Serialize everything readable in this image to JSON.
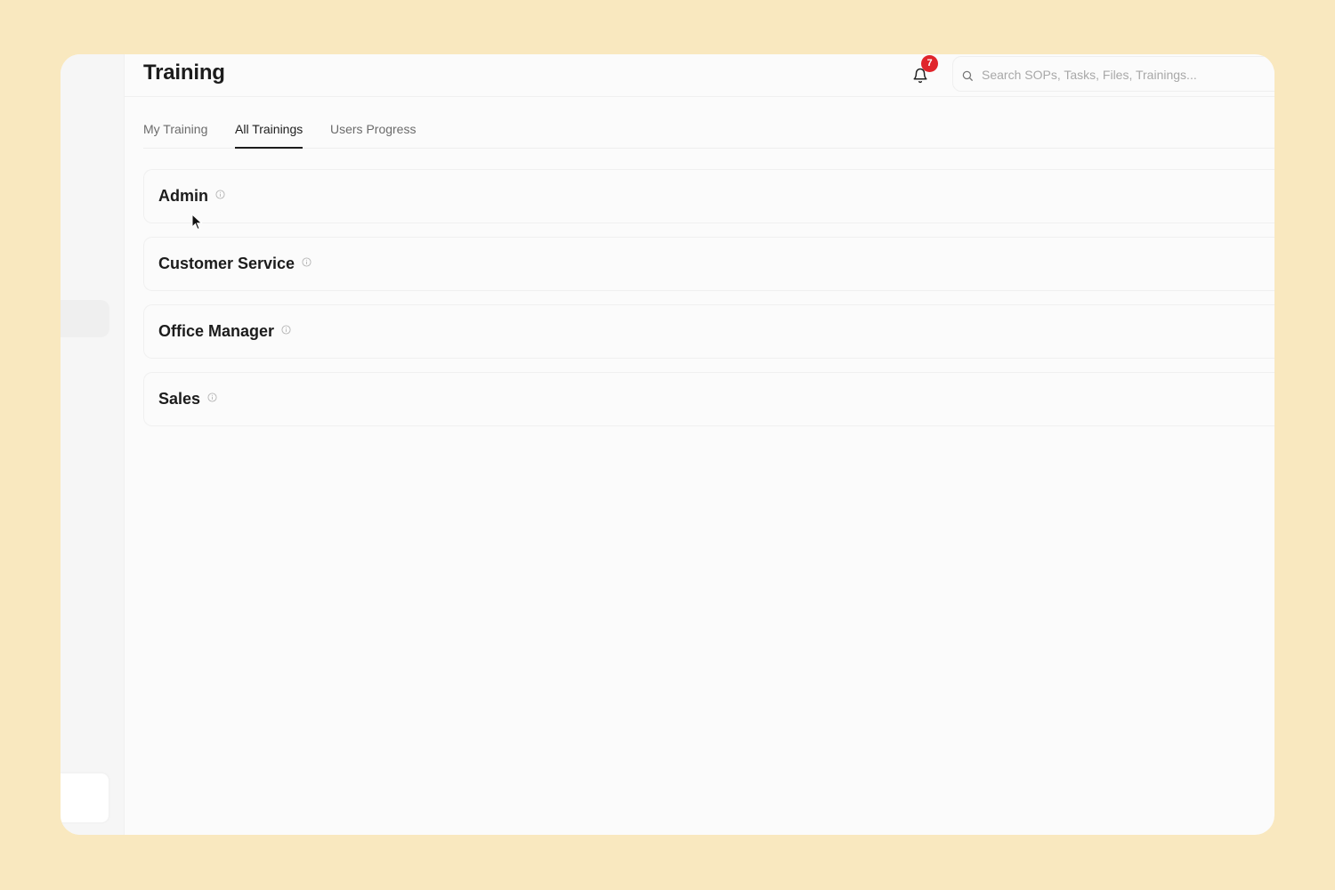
{
  "header": {
    "title": "Training",
    "notification_count": "7",
    "search_placeholder": "Search SOPs, Tasks, Files, Trainings..."
  },
  "tabs": [
    {
      "label": "My Training",
      "active": false
    },
    {
      "label": "All Trainings",
      "active": true
    },
    {
      "label": "Users Progress",
      "active": false
    }
  ],
  "groups": [
    {
      "label": "Admin"
    },
    {
      "label": "Customer Service"
    },
    {
      "label": "Office Manager"
    },
    {
      "label": "Sales"
    }
  ],
  "colors": {
    "background": "#f9e8bf",
    "badge": "#e0242b",
    "text": "#1c1c1c"
  },
  "icons": [
    "bell-icon",
    "search-icon",
    "info-icon"
  ]
}
